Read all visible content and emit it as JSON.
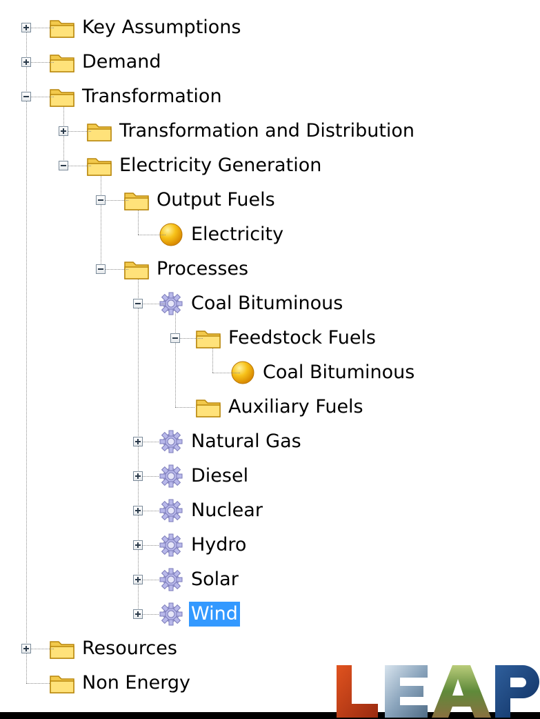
{
  "tree": {
    "items": [
      {
        "label": "Key Assumptions",
        "icon": "folder-icon",
        "expander": "plus"
      },
      {
        "label": "Demand",
        "icon": "folder-icon",
        "expander": "plus"
      },
      {
        "label": "Transformation",
        "icon": "folder-icon",
        "expander": "minus"
      },
      {
        "label": "Transformation and Distribution",
        "icon": "folder-icon",
        "expander": "plus"
      },
      {
        "label": "Electricity Generation",
        "icon": "folder-icon",
        "expander": "minus"
      },
      {
        "label": "Output Fuels",
        "icon": "folder-icon",
        "expander": "minus"
      },
      {
        "label": "Electricity",
        "icon": "fuel-sphere-icon",
        "expander": "none"
      },
      {
        "label": "Processes",
        "icon": "folder-icon",
        "expander": "minus"
      },
      {
        "label": "Coal Bituminous",
        "icon": "gear-icon",
        "expander": "minus"
      },
      {
        "label": "Feedstock Fuels",
        "icon": "folder-icon",
        "expander": "minus"
      },
      {
        "label": "Coal Bituminous",
        "icon": "fuel-sphere-icon",
        "expander": "none"
      },
      {
        "label": "Auxiliary Fuels",
        "icon": "folder-icon",
        "expander": "none"
      },
      {
        "label": "Natural Gas",
        "icon": "gear-icon",
        "expander": "plus"
      },
      {
        "label": "Diesel",
        "icon": "gear-icon",
        "expander": "plus"
      },
      {
        "label": "Nuclear",
        "icon": "gear-icon",
        "expander": "plus"
      },
      {
        "label": "Hydro",
        "icon": "gear-icon",
        "expander": "plus"
      },
      {
        "label": "Solar",
        "icon": "gear-icon",
        "expander": "plus"
      },
      {
        "label": "Wind",
        "icon": "gear-icon",
        "expander": "plus",
        "selected": true
      },
      {
        "label": "Resources",
        "icon": "folder-icon",
        "expander": "plus"
      },
      {
        "label": "Non Energy",
        "icon": "folder-icon",
        "expander": "none"
      }
    ]
  },
  "logo": {
    "text": "LEAP"
  },
  "colors": {
    "selection": "#3399ff",
    "folder": "#f2c94c",
    "sphere": "#f5a800",
    "gear": "#9a9ad8"
  }
}
